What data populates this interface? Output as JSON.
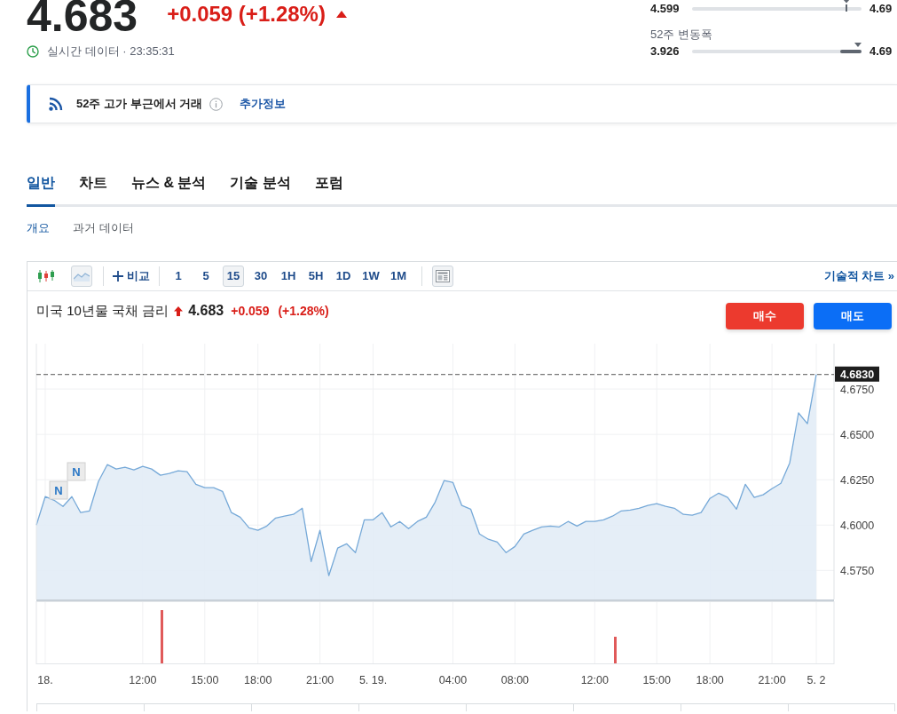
{
  "quote": {
    "price": "4.683",
    "change": "+0.059 (+1.28%)",
    "rising": true,
    "status": "실시간 데이터 · 23:35:31"
  },
  "ranges": [
    {
      "kind": "tick",
      "low": "4.599",
      "high": "4.69",
      "level": 0.91
    },
    {
      "kind": "band",
      "label": "52주 변동폭",
      "low": "3.926",
      "high": "4.69",
      "level": 0.98
    }
  ],
  "alert": {
    "text": "52주 고가 부근에서 거래",
    "link": "추가정보"
  },
  "tabs": [
    {
      "label": "일반",
      "selected": true
    },
    {
      "label": "차트",
      "selected": false
    },
    {
      "label": "뉴스 & 분석",
      "selected": false
    },
    {
      "label": "기술 분석",
      "selected": false
    },
    {
      "label": "포럼",
      "selected": false
    }
  ],
  "subtabs": [
    {
      "label": "개요",
      "selected": true
    },
    {
      "label": "과거 데이터",
      "selected": false
    }
  ],
  "chart": {
    "toolbar": {
      "chart_types": [
        {
          "kind": "candles",
          "selected": false
        },
        {
          "kind": "area",
          "selected": true
        }
      ],
      "compare": "비교",
      "intervals": [
        {
          "label": "1",
          "selected": false
        },
        {
          "label": "5",
          "selected": false
        },
        {
          "label": "15",
          "selected": true
        },
        {
          "label": "30",
          "selected": false
        },
        {
          "label": "1H",
          "selected": false
        },
        {
          "label": "5H",
          "selected": false
        },
        {
          "label": "1D",
          "selected": false
        },
        {
          "label": "1W",
          "selected": false
        },
        {
          "label": "1M",
          "selected": false
        }
      ],
      "link": "기술적 차트 »"
    },
    "header": {
      "title": "미국 10년물 국채 금리",
      "rising": true,
      "price": "4.683",
      "change": "+0.059",
      "change_pct": "(+1.28%)"
    },
    "actions": [
      {
        "kind": "buy",
        "label": "매수"
      },
      {
        "kind": "sell",
        "label": "매도"
      }
    ],
    "news_markers": [
      {
        "label": "N"
      },
      {
        "label": "N"
      }
    ],
    "chart_data": {
      "type": "area",
      "categories": [
        null,
        "18.",
        null,
        null,
        null,
        null,
        null,
        null,
        null,
        null,
        null,
        null,
        "12:00",
        null,
        null,
        null,
        null,
        null,
        null,
        "15:00",
        null,
        null,
        null,
        null,
        null,
        "18:00",
        null,
        null,
        null,
        null,
        null,
        null,
        "21:00",
        null,
        null,
        null,
        null,
        null,
        "5. 19.",
        null,
        null,
        null,
        null,
        null,
        null,
        null,
        null,
        "04:00",
        null,
        null,
        null,
        null,
        null,
        null,
        "08:00",
        null,
        null,
        null,
        null,
        null,
        null,
        null,
        null,
        "12:00",
        null,
        null,
        null,
        null,
        null,
        null,
        "15:00",
        null,
        null,
        null,
        null,
        null,
        "18:00",
        null,
        null,
        null,
        null,
        null,
        null,
        "21:00",
        null,
        null,
        null,
        null,
        "5. 2"
      ],
      "values": [
        4.6,
        4.6157,
        4.6137,
        4.6103,
        4.6157,
        4.6069,
        4.6078,
        4.624,
        4.6333,
        4.6309,
        4.6319,
        4.6304,
        4.6324,
        4.6309,
        4.6275,
        4.6284,
        4.6299,
        4.6294,
        4.6225,
        4.6206,
        4.6206,
        4.6186,
        4.6069,
        4.6044,
        4.5985,
        4.5971,
        4.5995,
        4.6039,
        4.6049,
        4.6059,
        4.6093,
        4.5799,
        4.5971,
        4.5721,
        4.5873,
        4.5897,
        4.5848,
        4.6029,
        4.6029,
        4.6069,
        4.599,
        4.602,
        4.598,
        4.602,
        4.6044,
        4.6127,
        4.6245,
        4.6235,
        4.6108,
        4.6088,
        4.5951,
        4.5922,
        4.5907,
        4.5848,
        4.5882,
        4.5951,
        4.5971,
        4.599,
        4.5995,
        4.599,
        4.602,
        4.5995,
        4.602,
        4.602,
        4.6029,
        4.6049,
        4.6078,
        4.6083,
        4.6093,
        4.6108,
        4.6118,
        4.6103,
        4.6093,
        4.6059,
        4.6054,
        4.6069,
        4.6147,
        4.6176,
        4.6152,
        4.6088,
        4.6225,
        4.6152,
        4.6167,
        4.6201,
        4.623,
        4.6343,
        4.6618,
        4.6559,
        4.683
      ],
      "ylim": [
        4.559,
        4.7
      ],
      "yticks": [
        {
          "value": 4.575,
          "label": "4.5750"
        },
        {
          "value": 4.6,
          "label": "4.6000"
        },
        {
          "value": 4.625,
          "label": "4.6250"
        },
        {
          "value": 4.65,
          "label": "4.6500"
        },
        {
          "value": 4.675,
          "label": "4.6750"
        }
      ],
      "grid": true,
      "ref_lines": [
        {
          "axis": "y",
          "value": 4.683,
          "label": "4.6830"
        }
      ]
    }
  }
}
